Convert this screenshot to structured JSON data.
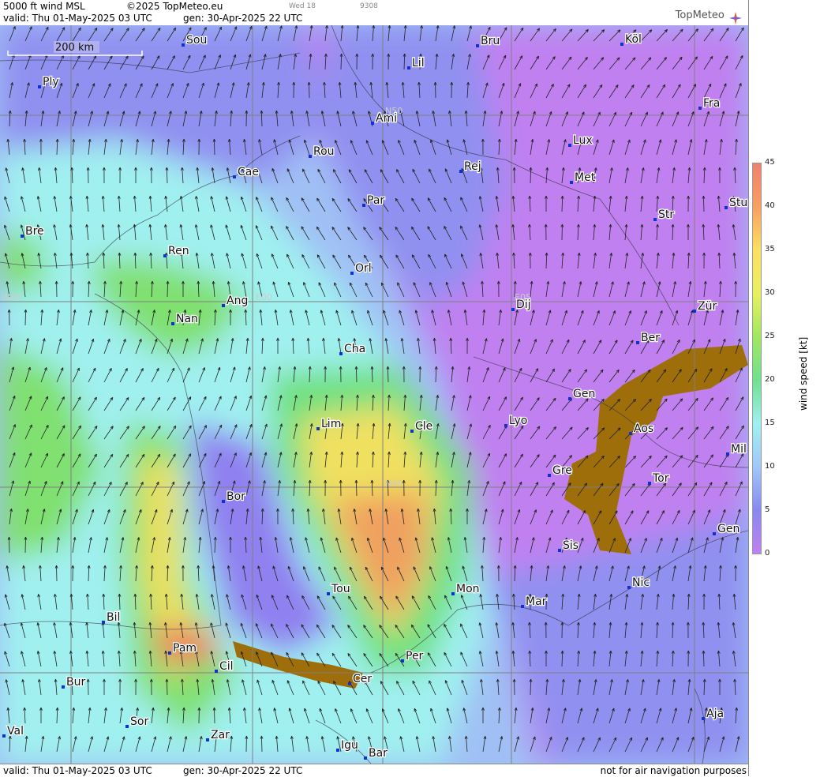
{
  "header": {
    "product": "5000 ft wind MSL",
    "copyright": "©2025 TopMeteo.eu",
    "day": "Wed 18",
    "code": "9308",
    "valid": "valid:  Thu  01-May-2025  03 UTC",
    "gen": "gen:  30-Apr-2025 22 UTC",
    "brand": "TopMeteo"
  },
  "footer": {
    "valid": "valid:  Thu  01-May-2025  03 UTC",
    "gen": "gen:  30-Apr-2025 22 UTC",
    "disclaimer": "not for air navigation purposes"
  },
  "scale_bar": "200 km",
  "grid_labels": [
    "N50",
    "N45",
    "W05",
    "E00",
    "E05"
  ],
  "legend": {
    "title": "wind  speed  [kt]",
    "ticks": [
      "45",
      "40",
      "35",
      "30",
      "25",
      "20",
      "15",
      "10",
      "5",
      "0"
    ],
    "colors": [
      "#f08070",
      "#f8a060",
      "#fce060",
      "#e8f060",
      "#a0e860",
      "#70e090",
      "#a0f0f0",
      "#a0c8f8",
      "#8888f0",
      "#c080f0"
    ]
  },
  "cities": [
    {
      "n": "Sou"
    },
    {
      "n": "Lil"
    },
    {
      "n": "Bru"
    },
    {
      "n": "Köl"
    },
    {
      "n": "Ply"
    },
    {
      "n": "Ami"
    },
    {
      "n": "Fra"
    },
    {
      "n": "Lux"
    },
    {
      "n": "Rou"
    },
    {
      "n": "Cae"
    },
    {
      "n": "Rej"
    },
    {
      "n": "Met"
    },
    {
      "n": "Par"
    },
    {
      "n": "Str"
    },
    {
      "n": "Stu"
    },
    {
      "n": "Bre"
    },
    {
      "n": "Ren"
    },
    {
      "n": "Orl"
    },
    {
      "n": "Ang"
    },
    {
      "n": "Dij"
    },
    {
      "n": "Zür"
    },
    {
      "n": "Nan"
    },
    {
      "n": "Ber"
    },
    {
      "n": "Cha"
    },
    {
      "n": "Gen"
    },
    {
      "n": "Lim"
    },
    {
      "n": "Cle"
    },
    {
      "n": "Lyo"
    },
    {
      "n": "Aos"
    },
    {
      "n": "Mil"
    },
    {
      "n": "Gre"
    },
    {
      "n": "Bor"
    },
    {
      "n": "Tor"
    },
    {
      "n": "Gen"
    },
    {
      "n": "Sis"
    },
    {
      "n": "Tou"
    },
    {
      "n": "Mon"
    },
    {
      "n": "Nic"
    },
    {
      "n": "Mar"
    },
    {
      "n": "Bil"
    },
    {
      "n": "Pam"
    },
    {
      "n": "Cil"
    },
    {
      "n": "Per"
    },
    {
      "n": "Bur"
    },
    {
      "n": "Cer"
    },
    {
      "n": "Sor"
    },
    {
      "n": "Aja"
    },
    {
      "n": "Val"
    },
    {
      "n": "Zar"
    },
    {
      "n": "Igu"
    },
    {
      "n": "Bar"
    }
  ]
}
